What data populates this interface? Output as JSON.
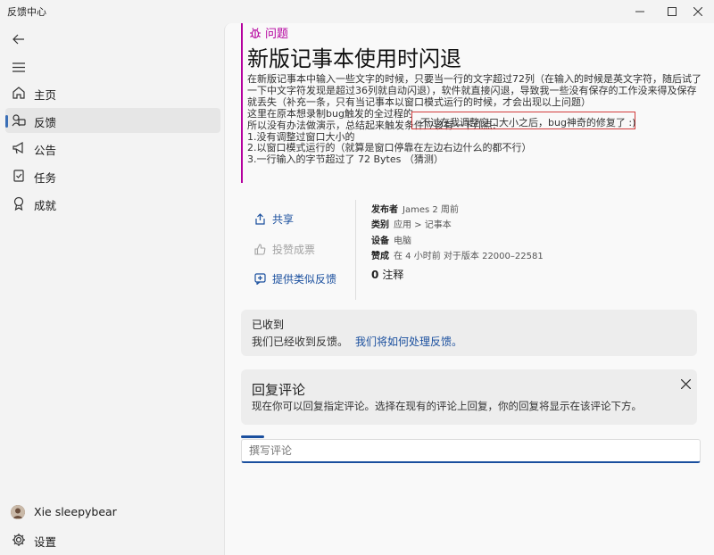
{
  "window": {
    "title": "反馈中心"
  },
  "nav": {
    "items": [
      {
        "label": "主页",
        "icon": "home-icon"
      },
      {
        "label": "反馈",
        "icon": "feedback-icon",
        "active": true
      },
      {
        "label": "公告",
        "icon": "megaphone-icon"
      },
      {
        "label": "任务",
        "icon": "task-icon"
      },
      {
        "label": "成就",
        "icon": "badge-icon"
      }
    ],
    "user": "Xie sleepybear",
    "settings": "设置"
  },
  "feedback": {
    "type": "问题",
    "title": "新版记事本使用时闪退",
    "description": [
      "在新版记事本中输入一些文字的时候，只要当一行的文字超过72列（在输入的时候是英文字符，随后试了",
      "一下中文字符发现是超过36列就自动闪退），软件就直接闪退，导致我一些没有保存的工作没来得及保存",
      "就丢失（补充一条，只有当记事本以窗口模式运行的时候，才会出现以上问题）",
      "这里在原本想录制bug触发的全过程的",
      "所以没有办法做演示，总结起来触发条件应该有一下几点:",
      "1.没有调整过窗口大小的",
      "2.以窗口模式运行的（就算是窗口停靠在左边右边什么的都不行）",
      "3.一行输入的字节超过了 72 Bytes （猜测）"
    ],
    "highlight": "不过在我调整窗口大小之后，bug神奇的修复了 :)",
    "actions": {
      "share": "共享",
      "vote": "投赞成票",
      "similar": "提供类似反馈"
    },
    "meta": {
      "poster_label": "发布者",
      "poster": "James 2 周前",
      "category_label": "类别",
      "category": "应用 > 记事本",
      "device_label": "设备",
      "device": "电脑",
      "upvote_label": "赞成",
      "upvote": "在 4 小时前 对于版本 22000–22581"
    },
    "comments_count": "0",
    "comments_label": "注释"
  },
  "status_card": {
    "title": "已收到",
    "text": "我们已经收到反馈。",
    "link": "我们将如何处理反馈。"
  },
  "reply_card": {
    "title": "回复评论",
    "text": "现在你可以回复指定评论。选择在现有的评论上回复，你的回复将显示在该评论下方。"
  },
  "comment_input": {
    "placeholder": "撰写评论"
  },
  "colors": {
    "accent": "#1a4f9e",
    "bug": "#b4009e",
    "highlight_border": "#d23c3c"
  }
}
